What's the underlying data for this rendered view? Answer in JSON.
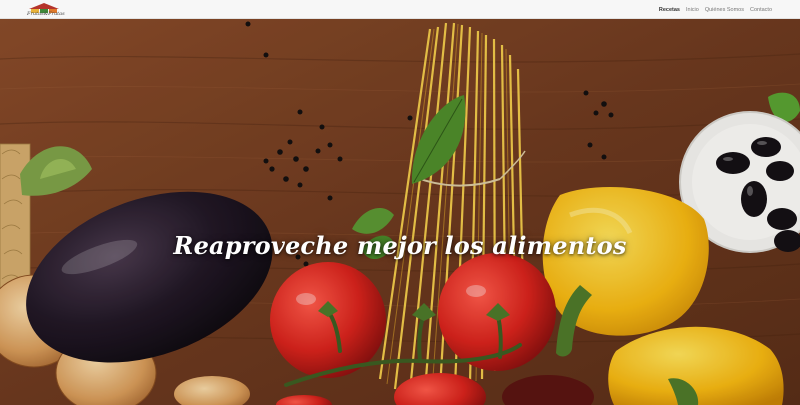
{
  "brand": {
    "name": "Frutas&Frutas",
    "logo_colors": [
      "#b5342b",
      "#e8b23a",
      "#3f8a3a"
    ]
  },
  "nav": {
    "items": [
      {
        "label": "Recetas",
        "active": true
      },
      {
        "label": "Inicio",
        "active": false
      },
      {
        "label": "Quiénes Somos",
        "active": false
      },
      {
        "label": "Contacto",
        "active": false
      }
    ]
  },
  "hero": {
    "title": "Reaproveche mejor los alimentos",
    "image_description_icons": [
      "eggplant",
      "spaghetti",
      "tomato",
      "yellow-pepper",
      "onion",
      "olives",
      "basil"
    ]
  },
  "colors": {
    "navbar_bg": "#f7f7f7",
    "wood": "#7a4324",
    "title_text": "#ffffff"
  }
}
